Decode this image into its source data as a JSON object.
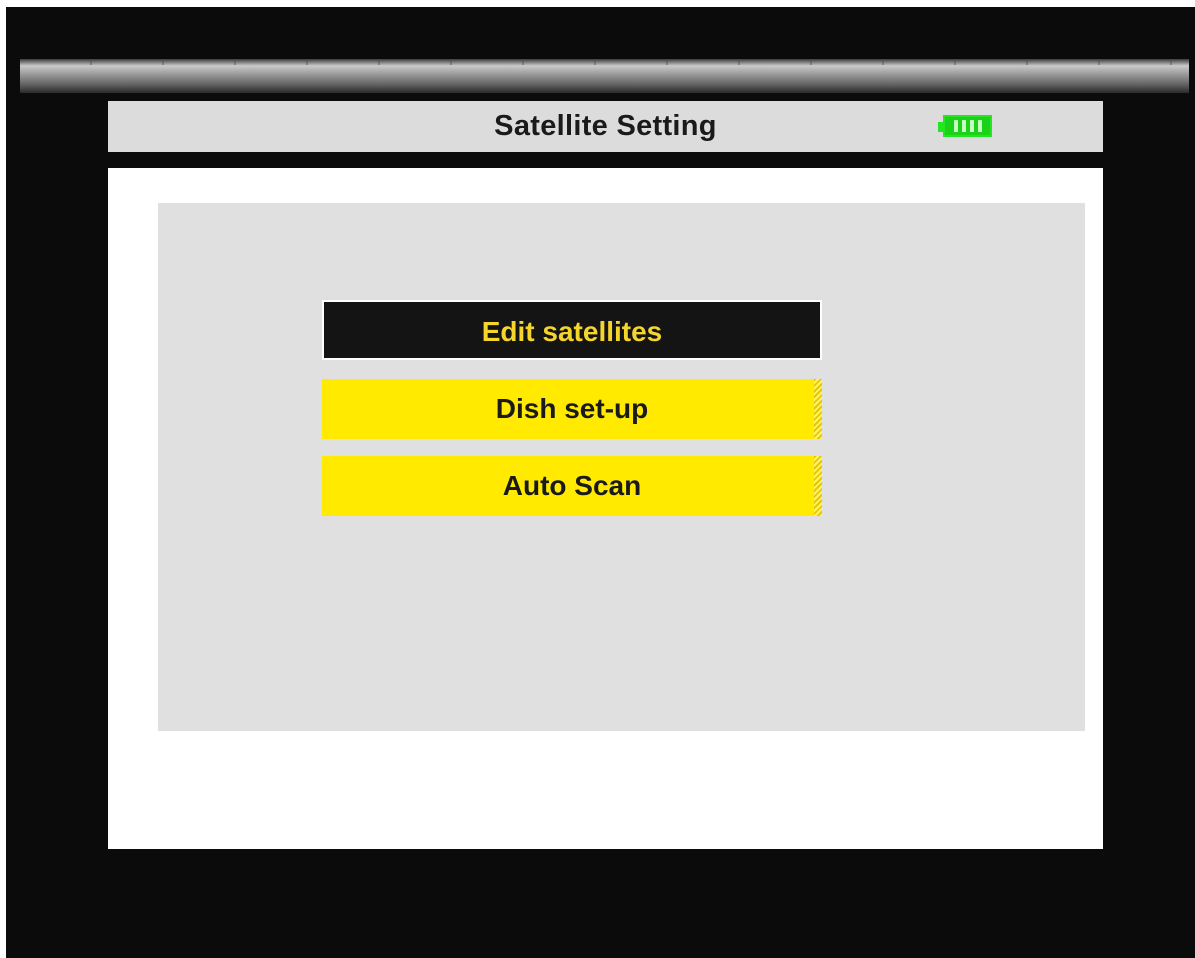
{
  "header": {
    "title": "Satellite Setting",
    "battery_icon": "battery-full-icon",
    "battery_color": "#23e620"
  },
  "menu": {
    "items": [
      {
        "label": "Edit satellites",
        "selected": true
      },
      {
        "label": "Dish set-up",
        "selected": false
      },
      {
        "label": "Auto Scan",
        "selected": false
      }
    ]
  },
  "colors": {
    "selected_bg": "#141414",
    "selected_text": "#f5d52a",
    "item_bg": "#ffea00",
    "item_text": "#1a1a1a",
    "panel_bg": "#e0e0e0",
    "screen_bg": "#0b0b0b"
  }
}
